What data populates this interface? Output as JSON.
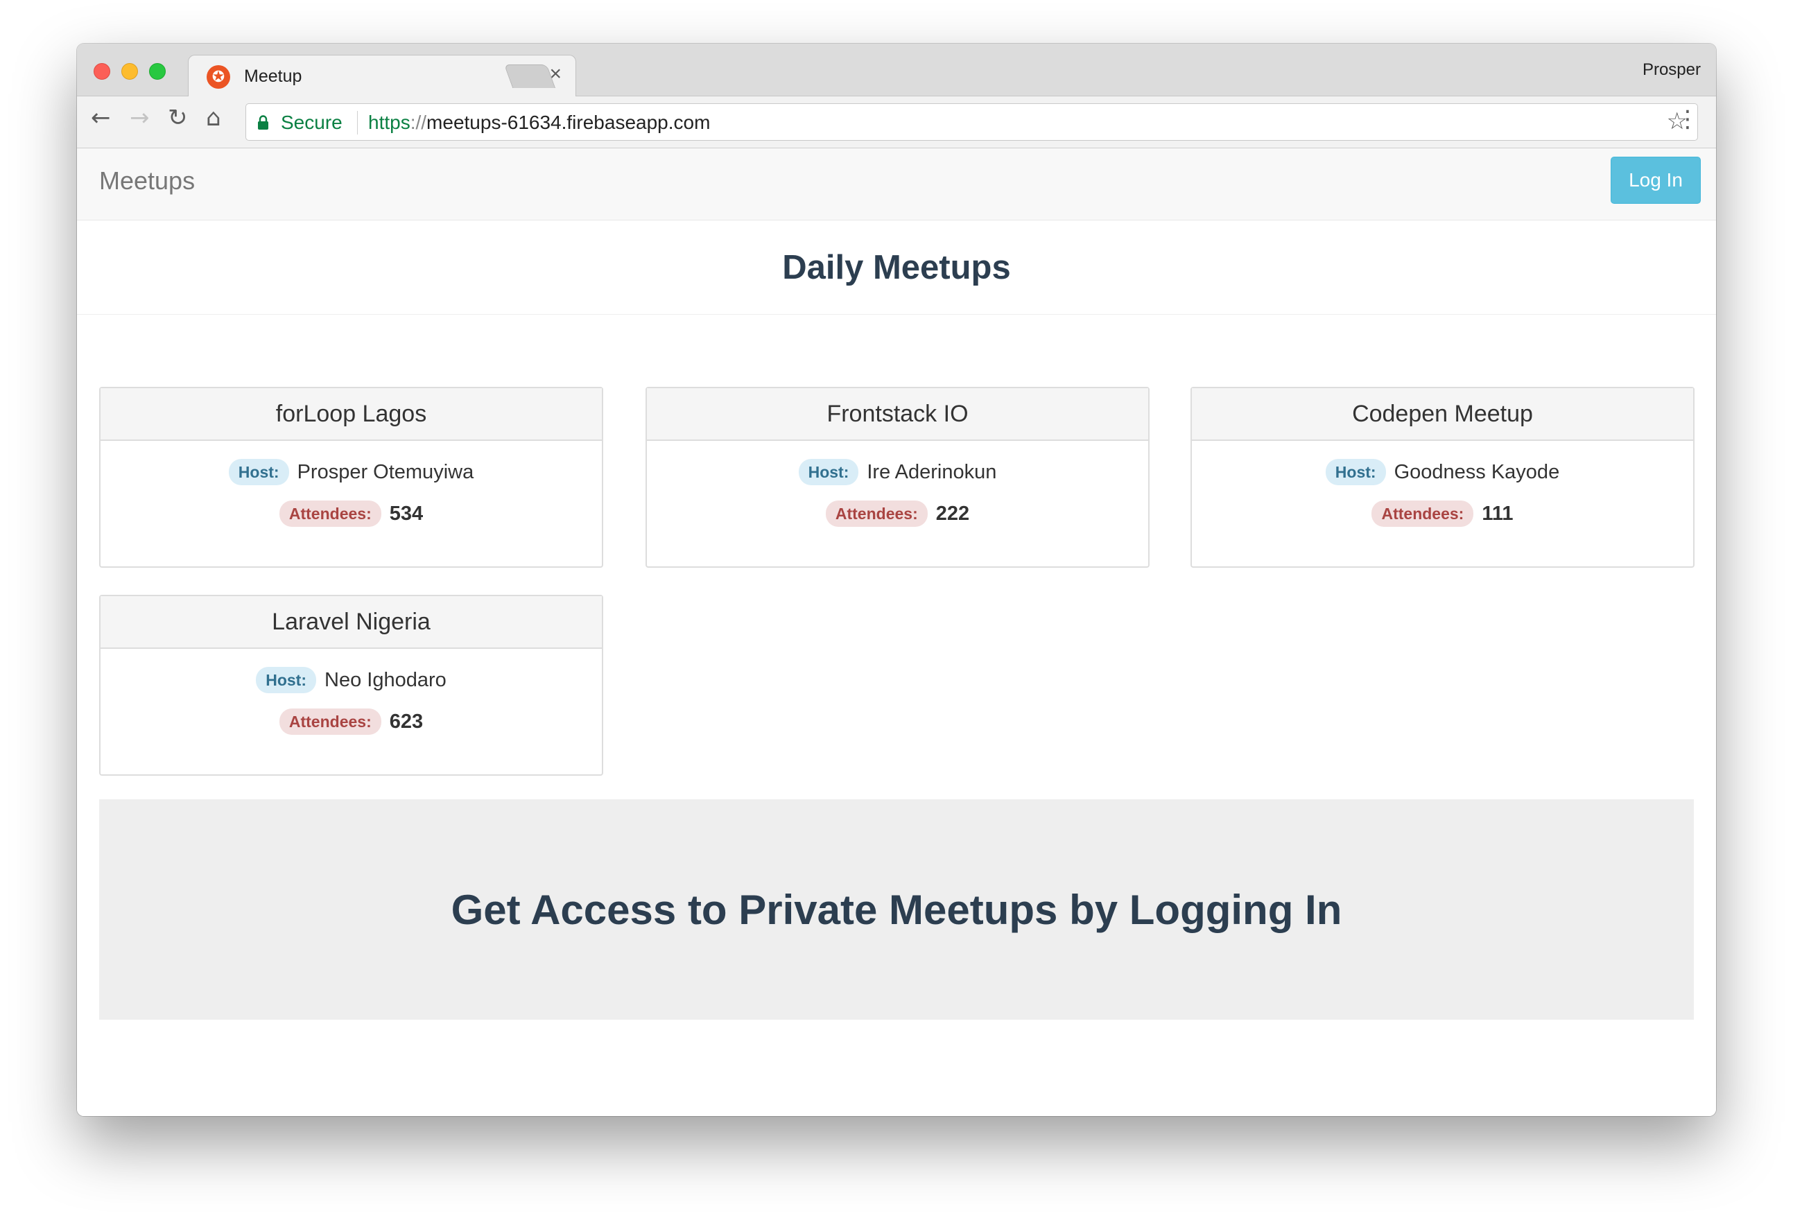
{
  "browser": {
    "tab_title": "Meetup",
    "tab_close": "×",
    "profile_name": "Prosper",
    "secure_label": "Secure",
    "url_scheme": "https",
    "url_scheme_sep": "://",
    "url_host": "meetups-61634.firebaseapp.com",
    "icons": {
      "back": "←",
      "forward": "→",
      "reload": "↻",
      "home": "⌂",
      "bookmark": "☆",
      "menu": "⋮",
      "favicon": "✪"
    }
  },
  "navbar": {
    "brand": "Meetups",
    "login_label": "Log In"
  },
  "header": {
    "title": "Daily Meetups"
  },
  "labels": {
    "host": "Host:",
    "attendees": "Attendees:"
  },
  "meetups": [
    {
      "name": "forLoop Lagos",
      "host": "Prosper Otemuyiwa",
      "attendees": "534"
    },
    {
      "name": "Frontstack IO",
      "host": "Ire Aderinokun",
      "attendees": "222"
    },
    {
      "name": "Codepen Meetup",
      "host": "Goodness Kayode",
      "attendees": "111"
    },
    {
      "name": "Laravel Nigeria",
      "host": "Neo Ighodaro",
      "attendees": "623"
    }
  ],
  "cta": {
    "text": "Get Access to Private Meetups by Logging In"
  },
  "colors": {
    "info": "#5bc0de",
    "host_badge_bg": "#d9edf7",
    "host_badge_text": "#31708f",
    "attendees_badge_bg": "#f2dede",
    "attendees_badge_text": "#a94442",
    "secure_green": "#0b8043",
    "favicon": "#eb5424"
  }
}
